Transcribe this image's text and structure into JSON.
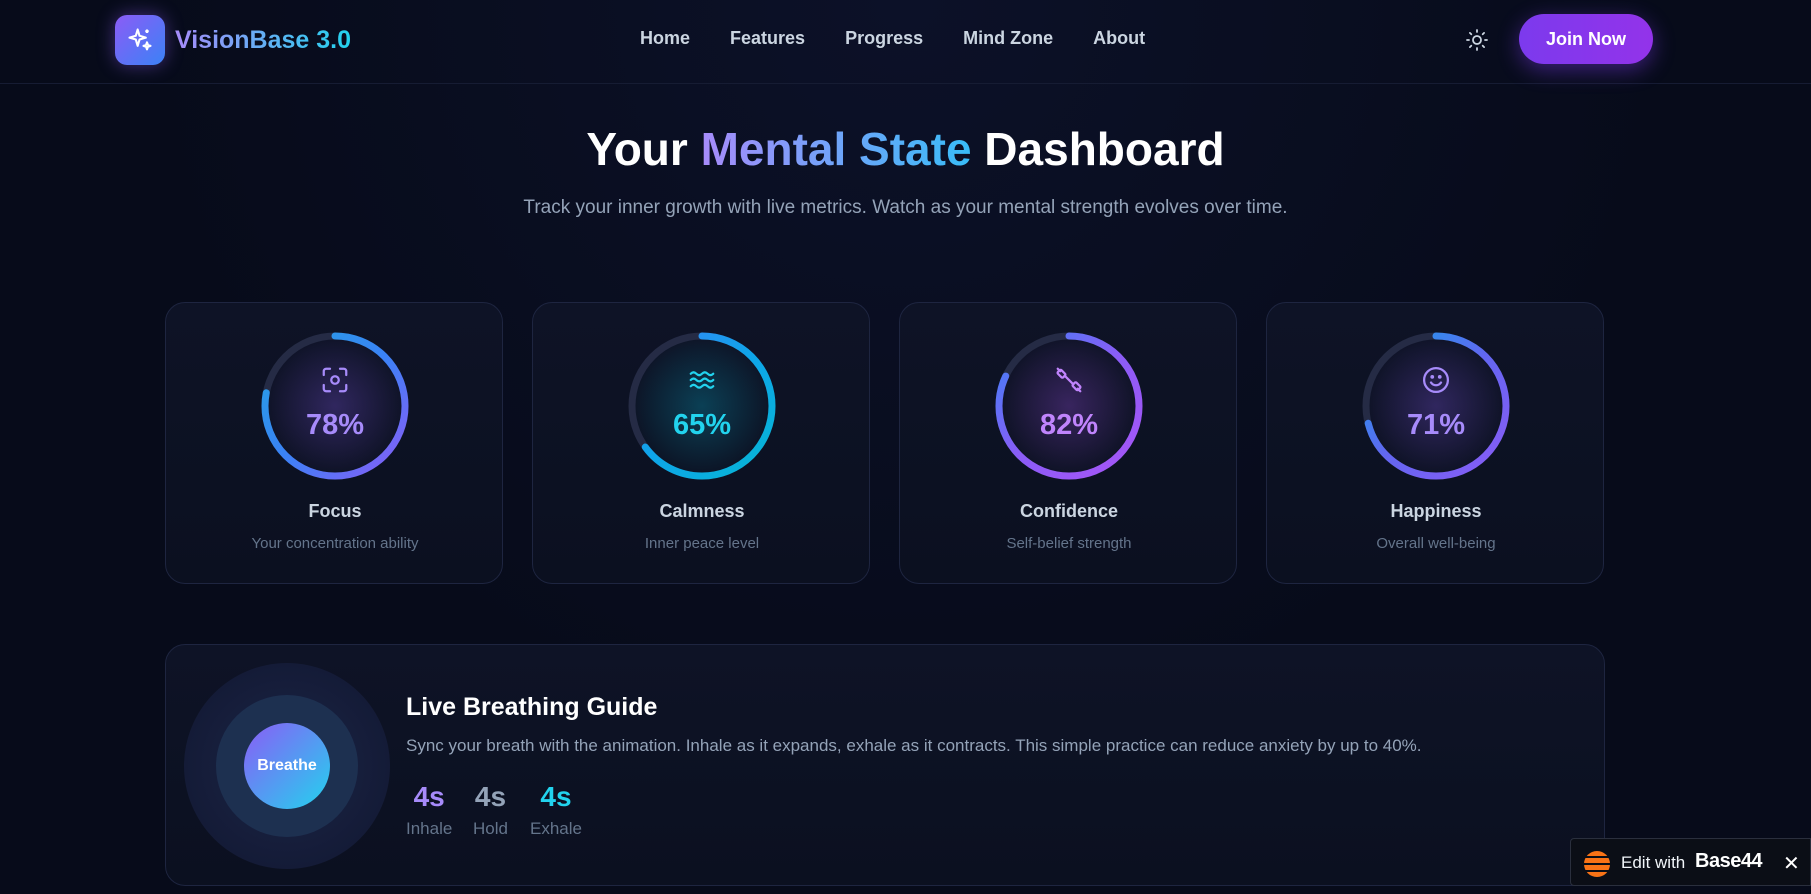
{
  "nav": {
    "brand": "VisionBase 3.0",
    "links": [
      "Home",
      "Features",
      "Progress",
      "Mind Zone",
      "About"
    ],
    "join_label": "Join Now"
  },
  "hero": {
    "title_start": "Your ",
    "title_highlight": "Mental State",
    "title_end": " Dashboard",
    "subtitle": "Track your inner growth with live metrics. Watch as your mental strength evolves over time."
  },
  "metrics": [
    {
      "value_text": "78%",
      "fraction": 0.78,
      "label": "Focus",
      "desc": "Your concentration ability",
      "icon": "focus-icon",
      "colors": [
        "#8b5cf6",
        "#3b82f6",
        "#22a3e0"
      ],
      "text_color": "#a78bfa"
    },
    {
      "value_text": "65%",
      "fraction": 0.65,
      "label": "Calmness",
      "desc": "Inner peace level",
      "icon": "waves-icon",
      "colors": [
        "#06b6d4",
        "#0ea5e9",
        "#3b82f6"
      ],
      "text_color": "#22d3ee"
    },
    {
      "value_text": "82%",
      "fraction": 0.82,
      "label": "Confidence",
      "desc": "Self-belief strength",
      "icon": "dumbbell-icon",
      "colors": [
        "#a855f7",
        "#8b5cf6",
        "#3b82f6"
      ],
      "text_color": "#c084fc"
    },
    {
      "value_text": "71%",
      "fraction": 0.71,
      "label": "Happiness",
      "desc": "Overall well-being",
      "icon": "smile-icon",
      "colors": [
        "#8b5cf6",
        "#6366f1",
        "#0ea5e9"
      ],
      "text_color": "#a78bfa"
    }
  ],
  "breathing": {
    "title": "Live Breathing Guide",
    "desc": "Sync your breath with the animation. Inhale as it expands, exhale as it contracts. This simple practice can reduce anxiety by up to 40%.",
    "center_label": "Breathe",
    "phases": [
      {
        "value": "4s",
        "label": "Inhale",
        "color": "#a78bfa"
      },
      {
        "value": "4s",
        "label": "Hold",
        "color": "#94a3b8"
      },
      {
        "value": "4s",
        "label": "Exhale",
        "color": "#22d3ee"
      }
    ]
  },
  "badge": {
    "text": "Edit with",
    "brand": "Base44",
    "close": "✕"
  }
}
